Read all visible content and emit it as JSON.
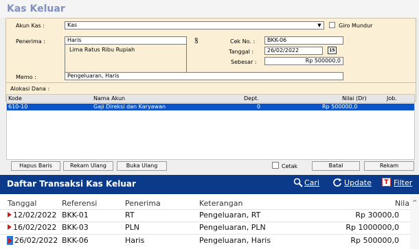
{
  "form": {
    "title": "Kas Keluar",
    "akun_kas": {
      "label": "Akun Kas :",
      "value": "Kas"
    },
    "giro_mundur": {
      "label": "Giro Mundur",
      "checked": false
    },
    "penerima": {
      "label": "Penerima :",
      "value": "Haris",
      "terbilang": "Lima Ratus Ribu Rupiah"
    },
    "cek_no": {
      "label": "Cek No. :",
      "value": "BKK-06"
    },
    "tanggal": {
      "label": "Tanggal :",
      "value": "26/02/2022",
      "calendar_glyph": "15"
    },
    "sebesar": {
      "label": "Sebesar :",
      "value": "Rp 500000,0"
    },
    "memo": {
      "label": "Memo :",
      "value": "Pengeluaran, Haris"
    },
    "alokasi_label": "Alokasi Dana :",
    "grid": {
      "headers": {
        "kode": "Kode",
        "nama_akun": "Nama Akun",
        "dept": "Dept.",
        "nilai": "Nilai (Dr)",
        "job": "Job."
      },
      "rows": [
        {
          "kode": "610-10",
          "nama_akun": "Gaji Direksi dan Karyawan",
          "dept": "0",
          "nilai": "Rp 500000,0",
          "job": ""
        }
      ]
    },
    "buttons": {
      "hapus_baris": "Hapus Baris",
      "rekam_ulang": "Rekam Ulang",
      "buka_ulang": "Buka Ulang",
      "cetak": "Cetak",
      "batal": "Batal",
      "rekam": "Rekam"
    }
  },
  "daftar": {
    "title": "Daftar Transaksi Kas Keluar",
    "tools": {
      "cari": "Cari",
      "update": "Update",
      "filter": "Filter",
      "filter_glyph": "T"
    },
    "columns": {
      "tanggal": "Tanggal",
      "referensi": "Referensi",
      "penerima": "Penerima",
      "keterangan": "Keterangan",
      "nilai": "Nilai"
    },
    "rows": [
      {
        "tanggal": "12/02/2022",
        "referensi": "BKK-01",
        "penerima": "RT",
        "keterangan": "Pengeluaran, RT",
        "nilai": "Rp 30000,0"
      },
      {
        "tanggal": "16/02/2022",
        "referensi": "BKK-03",
        "penerima": "PLN",
        "keterangan": "Pengeluaran, PLN",
        "nilai": "Rp 1000000,0"
      },
      {
        "tanggal": "26/02/2022",
        "referensi": "BKK-06",
        "penerima": "Haris",
        "keterangan": "Pengeluaran, Haris",
        "nilai": "Rp 500000,0"
      }
    ]
  },
  "colors": {
    "accent": "#0b3a8a",
    "selection": "#0a54c8",
    "form_bg": "#fbf0d5",
    "row_marker": "#d01818"
  }
}
